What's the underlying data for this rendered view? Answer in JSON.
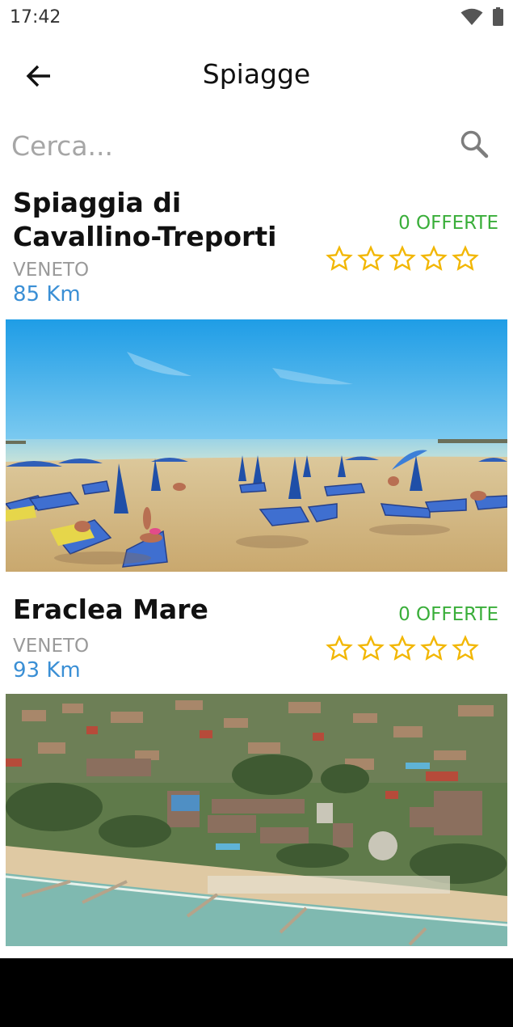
{
  "status_bar": {
    "time": "17:42"
  },
  "header": {
    "title": "Spiagge",
    "back_icon": "arrow-left-icon"
  },
  "search": {
    "placeholder": "Cerca...",
    "icon": "search-icon"
  },
  "colors": {
    "star": "#f2b705",
    "offers": "#3aae3a",
    "distance": "#3a8fd5",
    "region": "#9a9a9a"
  },
  "beaches": [
    {
      "name": "Spiaggia di Cavallino-Treporti",
      "region": "VENETO",
      "distance": "85 Km",
      "offers": "0 OFFERTE",
      "rating": 0,
      "max_rating": 5
    },
    {
      "name": "Eraclea Mare",
      "region": "VENETO",
      "distance": "93 Km",
      "offers": "0 OFFERTE",
      "rating": 0,
      "max_rating": 5
    }
  ]
}
